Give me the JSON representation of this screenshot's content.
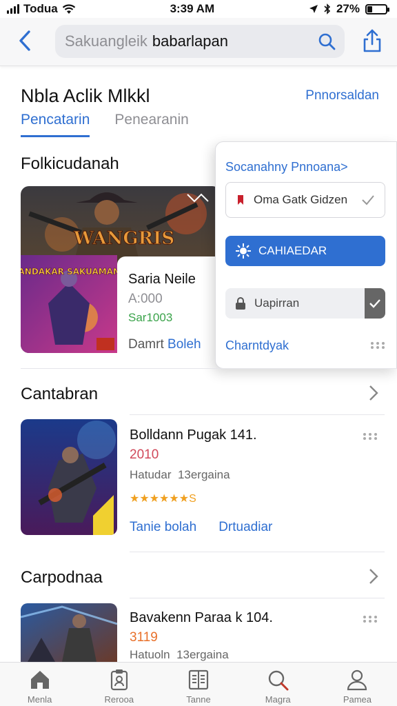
{
  "status_bar": {
    "carrier": "Todua",
    "time": "3:39 AM",
    "battery": "27%",
    "battery_fraction": 0.27
  },
  "search": {
    "placeholder": "Sakuangleik",
    "query": "babarlapan"
  },
  "page": {
    "title": "Nbla Aclik Mlkkl",
    "header_link": "Pnnorsaldan"
  },
  "tabs": [
    {
      "label": "Pencatarin",
      "active": true
    },
    {
      "label": "Penearanin",
      "active": false
    }
  ],
  "featured": {
    "section_title": "Folkicudanah",
    "name": "Saria Neile",
    "price": "A:000",
    "code": "Sar1003",
    "action_prefix": "Damrt",
    "action_link": "Boleh",
    "art_title": "WANGRIS",
    "art_subtitle": "BANDAKAR SAKUAMANS"
  },
  "popover": {
    "title": "Socanahny Pnnoana>",
    "select_value": "Oma Gatk Gidzen",
    "primary_button": "CAHIAEDAR",
    "secondary_button": "Uapirran",
    "link": "Charntdyak"
  },
  "sections": [
    {
      "title": "Cantabran",
      "name": "Bolldann Pugak 141.",
      "price": "2010",
      "price_color": "#d0485a",
      "meta_label": "Hatudar",
      "meta_value": "13ergaina",
      "stars": "★★★★★★S",
      "action_1": "Tanie bolah",
      "action_2": "Drtuadiar"
    },
    {
      "title": "Carpodnaa",
      "name": "Bavakenn Paraa k 104.",
      "price": "3119",
      "price_color": "#e8702a",
      "meta_label": "Hatuoln",
      "meta_value": "13ergaina"
    }
  ],
  "tab_bar": [
    {
      "label": "Menla",
      "icon": "home-icon"
    },
    {
      "label": "Rerooa",
      "icon": "clipboard-icon"
    },
    {
      "label": "Tanne",
      "icon": "book-icon"
    },
    {
      "label": "Magra",
      "icon": "search-icon"
    },
    {
      "label": "Pamea",
      "icon": "person-icon"
    }
  ],
  "colors": {
    "accent": "#2f6fd1",
    "green": "#3aa34a"
  }
}
